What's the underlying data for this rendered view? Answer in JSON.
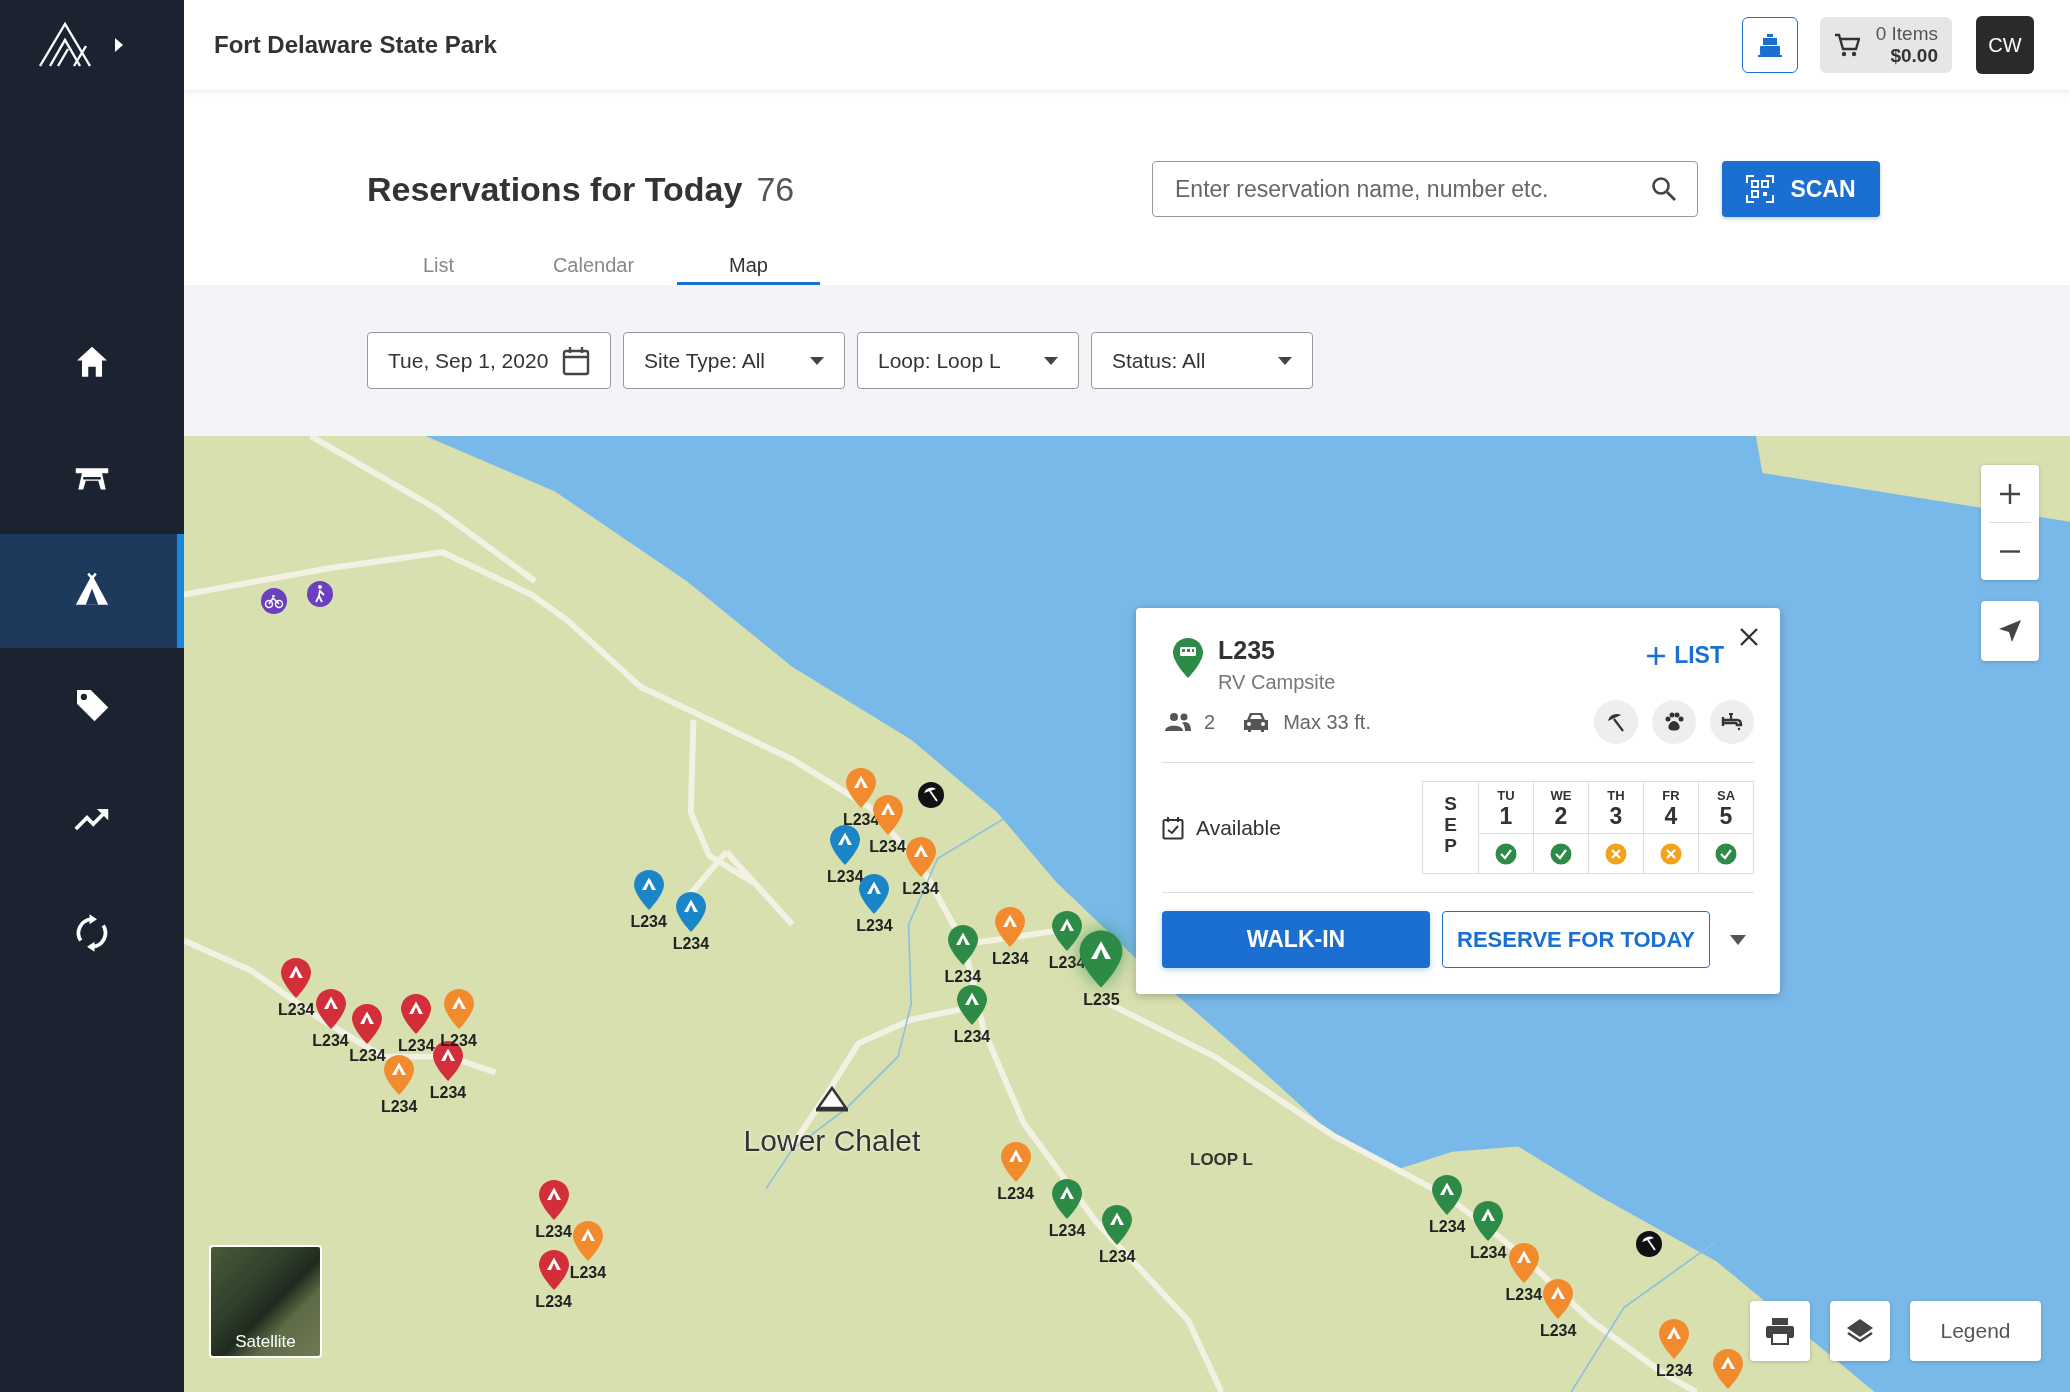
{
  "header": {
    "park_name": "Fort Delaware State Park",
    "cart": {
      "items": "0 Items",
      "total": "$0.00"
    },
    "avatar": "CW"
  },
  "sidebar": {
    "items": [
      {
        "kind": "home",
        "selected": false
      },
      {
        "kind": "picnic",
        "selected": false
      },
      {
        "kind": "tent",
        "selected": true
      },
      {
        "kind": "tag",
        "selected": false
      },
      {
        "kind": "trend",
        "selected": false
      },
      {
        "kind": "sync",
        "selected": false
      }
    ]
  },
  "page": {
    "title": "Reservations for Today",
    "count": "76",
    "search": {
      "placeholder": "Enter reservation name, number etc."
    },
    "scan_button": "SCAN"
  },
  "tabs": [
    {
      "label": "List",
      "selected": false
    },
    {
      "label": "Calendar",
      "selected": false
    },
    {
      "label": "Map",
      "selected": true
    }
  ],
  "filters": [
    {
      "kind": "date",
      "label": "Tue, Sep 1, 2020"
    },
    {
      "kind": "select",
      "label": "Site Type: All"
    },
    {
      "kind": "select",
      "label": "Loop: Loop L"
    },
    {
      "kind": "select",
      "label": "Status: All"
    }
  ],
  "map": {
    "markers": [
      {
        "label": "L234",
        "color": "#d32f3a",
        "selected": false
      },
      {
        "label": "L234",
        "color": "#d32f3a",
        "selected": false
      },
      {
        "label": "L234",
        "color": "#d32f3a",
        "selected": false
      },
      {
        "label": "L234",
        "color": "#d32f3a",
        "selected": false
      },
      {
        "label": "L234",
        "color": "#d32f3a",
        "selected": false
      },
      {
        "label": "L234",
        "color": "#f28a2e",
        "selected": false
      },
      {
        "label": "L234",
        "color": "#f28a2e",
        "selected": false
      },
      {
        "label": "L234",
        "color": "#d32f3a",
        "selected": false
      },
      {
        "label": "L234",
        "color": "#f28a2e",
        "selected": false
      },
      {
        "label": "L234",
        "color": "#d32f3a",
        "selected": false
      },
      {
        "label": "L234",
        "color": "#1a86c8",
        "selected": false
      },
      {
        "label": "L234",
        "color": "#1a86c8",
        "selected": false
      },
      {
        "label": "L234",
        "color": "#f28a2e",
        "selected": false
      },
      {
        "label": "L234",
        "color": "#f28a2e",
        "selected": false
      },
      {
        "label": "L234",
        "color": "#1a86c8",
        "selected": false
      },
      {
        "label": "L234",
        "color": "#f28a2e",
        "selected": false
      },
      {
        "label": "L234",
        "color": "#1a86c8",
        "selected": false
      },
      {
        "label": "L234",
        "color": "#2e8b47",
        "selected": false
      },
      {
        "label": "L234",
        "color": "#f28a2e",
        "selected": false
      },
      {
        "label": "L234",
        "color": "#2e8b47",
        "selected": false
      },
      {
        "label": "L234",
        "color": "#2e8b47",
        "selected": false
      },
      {
        "label": "L235",
        "color": "#2e8b47",
        "selected": true
      },
      {
        "label": "L234",
        "color": "#f28a2e",
        "selected": false
      },
      {
        "label": "L234",
        "color": "#2e8b47",
        "selected": false
      },
      {
        "label": "L234",
        "color": "#2e8b47",
        "selected": false
      },
      {
        "label": "L234",
        "color": "#2e8b47",
        "selected": false
      },
      {
        "label": "L234",
        "color": "#2e8b47",
        "selected": false
      },
      {
        "label": "L234",
        "color": "#f28a2e",
        "selected": false
      },
      {
        "label": "L234",
        "color": "#f28a2e",
        "selected": false
      },
      {
        "label": "L234",
        "color": "#f28a2e",
        "selected": false
      },
      {
        "color": "#f28a2e",
        "selected": false
      }
    ],
    "place_label": "Lower Chalet",
    "loop_label": "LOOP L",
    "satellite_label": "Satellite",
    "legend_button": "Legend"
  },
  "popup": {
    "site": "L235",
    "type": "RV Campsite",
    "occupancy": "2",
    "max_length": "Max 33 ft.",
    "add_button": "LIST",
    "status": "Available",
    "month": "SEP",
    "days": [
      {
        "weekday": "TU",
        "date": "1",
        "available": true
      },
      {
        "weekday": "WE",
        "date": "2",
        "available": true
      },
      {
        "weekday": "TH",
        "date": "3",
        "available": false
      },
      {
        "weekday": "FR",
        "date": "4",
        "available": false
      },
      {
        "weekday": "SA",
        "date": "5",
        "available": true
      }
    ],
    "walk_in_button": "WALK-IN",
    "reserve_button": "RESERVE FOR TODAY"
  }
}
